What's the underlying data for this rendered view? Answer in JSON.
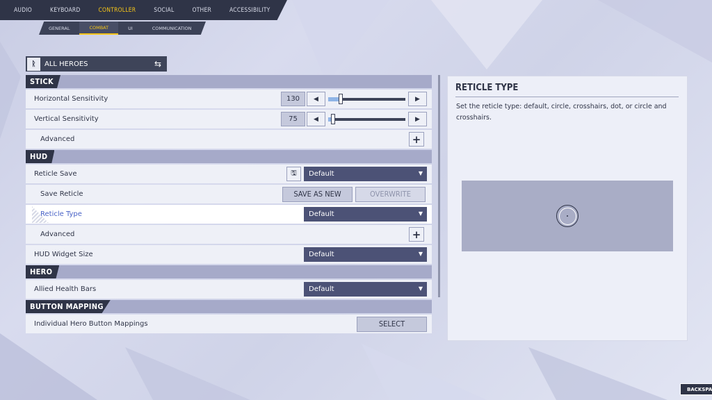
{
  "top_tabs": [
    "AUDIO",
    "KEYBOARD",
    "CONTROLLER",
    "SOCIAL",
    "OTHER",
    "ACCESSIBILITY"
  ],
  "sub_tabs": [
    "GENERAL",
    "COMBAT",
    "UI",
    "COMMUNICATION"
  ],
  "hero_selector": {
    "label": "ALL HEROES",
    "icon": "hero-logo-icon",
    "swap_icon": "swap-arrows-icon"
  },
  "sections": {
    "stick": "STICK",
    "hud": "HUD",
    "hero": "HERO",
    "button_mapping": "BUTTON MAPPING"
  },
  "stick": {
    "horizontal": {
      "label": "Horizontal Sensitivity",
      "value": "130",
      "level": 0.14
    },
    "vertical": {
      "label": "Vertical Sensitivity",
      "value": "75",
      "level": 0.04
    },
    "advanced": "Advanced"
  },
  "hud": {
    "reticle_save": {
      "label": "Reticle Save",
      "value": "Default"
    },
    "save_reticle": {
      "label": "Save Reticle",
      "save_new": "SAVE AS NEW",
      "overwrite": "OVERWRITE"
    },
    "reticle_type": {
      "label": "Reticle Type",
      "value": "Default"
    },
    "advanced": "Advanced",
    "widget_size": {
      "label": "HUD Widget Size",
      "value": "Default"
    }
  },
  "hero": {
    "allied_health": {
      "label": "Allied Health Bars",
      "value": "Default"
    }
  },
  "button_mapping": {
    "individual": {
      "label": "Individual Hero Button Mappings",
      "button": "SELECT"
    }
  },
  "info_panel": {
    "title": "RETICLE TYPE",
    "description": "Set the reticle type: default, circle, crosshairs, dot, or circle and crosshairs."
  },
  "footer": {
    "backspace": "BACKSPACE"
  },
  "colors": {
    "accent": "#f5c518",
    "nav_bg": "#2f3447",
    "dropdown_bg": "#4c5276",
    "selected_text": "#4a63c7"
  }
}
